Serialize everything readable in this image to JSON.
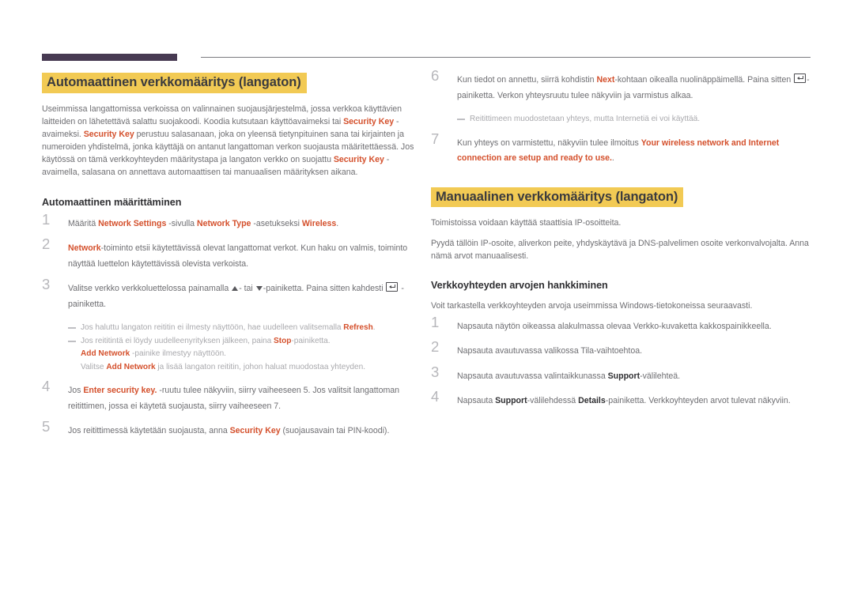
{
  "decor": {
    "bar_color": "#473a52",
    "line_color": "#7b7b80"
  },
  "theme": {
    "accent": "#d4502c",
    "highlight": "#f2ca54",
    "body_text": "#6e6e72",
    "note_text": "#a9a9ad",
    "number_color": "#b7b7bb",
    "heading_text": "#2f2f32"
  },
  "left_column": {
    "section_title": "Automaattinen verkkomääritys (langaton)",
    "intro": {
      "p1_a": "Useimmissa langattomissa verkoissa on valinnainen suojausjärjestelmä, jossa verkkoa käyttävien laitteiden on lähetettävä salattu suojakoodi. Koodia kutsutaan käyttöavaimeksi tai ",
      "p1_key1": "Security Key",
      "p1_b": " -avaimeksi. ",
      "p1_key2": "Security Key",
      "p1_c": " perustuu salasanaan, joka on yleensä tietynpituinen sana tai kirjainten ja numeroiden yhdistelmä, jonka käyttäjä on antanut langattoman verkon suojausta määritettäessä. Jos käytössä on tämä verkkoyhteyden määritystapa ja langaton verkko on suojattu ",
      "p1_key3": "Security Key",
      "p1_d": " -avaimella, salasana on annettava automaattisen tai manuaalisen määrityksen aikana."
    },
    "sub_title": "Automaattinen määrittäminen",
    "steps": [
      {
        "num": "1",
        "parts": [
          {
            "t": "Määritä ",
            "s": "plain"
          },
          {
            "t": "Network Settings",
            "s": "accent"
          },
          {
            "t": " -sivulla ",
            "s": "plain"
          },
          {
            "t": "Network Type",
            "s": "accent"
          },
          {
            "t": " -asetukseksi ",
            "s": "plain"
          },
          {
            "t": "Wireless",
            "s": "accent"
          },
          {
            "t": ".",
            "s": "plain"
          }
        ]
      },
      {
        "num": "2",
        "parts": [
          {
            "t": "Network",
            "s": "accent"
          },
          {
            "t": "-toiminto etsii käytettävissä olevat langattomat verkot. Kun haku on valmis, toiminto näyttää luettelon käytettävissä olevista verkoista.",
            "s": "plain"
          }
        ]
      },
      {
        "num": "3",
        "parts": [
          {
            "t": "Valitse verkko verkkoluettelossa painamalla ",
            "s": "plain"
          },
          {
            "t": "",
            "s": "tri-up"
          },
          {
            "t": "- tai ",
            "s": "plain"
          },
          {
            "t": "",
            "s": "tri-down"
          },
          {
            "t": "-painiketta. Paina sitten kahdesti ",
            "s": "plain"
          },
          {
            "t": "",
            "s": "enter-icon"
          },
          {
            "t": " -painiketta.",
            "s": "plain"
          }
        ],
        "notes": [
          {
            "type": "dash",
            "parts": [
              {
                "t": "Jos haluttu langaton reititin ei ilmesty näyttöön, hae uudelleen valitsemalla ",
                "s": "plain"
              },
              {
                "t": "Refresh",
                "s": "accent"
              },
              {
                "t": ".",
                "s": "plain"
              }
            ]
          },
          {
            "type": "dash",
            "parts": [
              {
                "t": "Jos reititintä ei löydy uudelleenyrityksen jälkeen, paina ",
                "s": "plain"
              },
              {
                "t": "Stop",
                "s": "accent"
              },
              {
                "t": "-painiketta.",
                "s": "plain"
              }
            ]
          },
          {
            "type": "sub",
            "parts": [
              {
                "t": "Add Network",
                "s": "accent"
              },
              {
                "t": " -painike ilmestyy näyttöön.",
                "s": "plain"
              }
            ]
          },
          {
            "type": "sub",
            "parts": [
              {
                "t": "Valitse ",
                "s": "plain"
              },
              {
                "t": "Add Network",
                "s": "accent"
              },
              {
                "t": " ja lisää langaton reititin, johon haluat muodostaa yhteyden.",
                "s": "plain"
              }
            ]
          }
        ]
      },
      {
        "num": "4",
        "parts": [
          {
            "t": "Jos ",
            "s": "plain"
          },
          {
            "t": "Enter security key.",
            "s": "accent"
          },
          {
            "t": " -ruutu tulee näkyviin, siirry vaiheeseen 5. Jos valitsit langattoman reitittimen, jossa ei käytetä suojausta, siirry vaiheeseen 7.",
            "s": "plain"
          }
        ]
      },
      {
        "num": "5",
        "parts": [
          {
            "t": "Jos reitittimessä käytetään suojausta, anna ",
            "s": "plain"
          },
          {
            "t": "Security Key",
            "s": "accent"
          },
          {
            "t": " (suojausavain tai PIN-koodi).",
            "s": "plain"
          }
        ]
      }
    ]
  },
  "right_column": {
    "steps_top": [
      {
        "num": "6",
        "parts": [
          {
            "t": "Kun tiedot on annettu, siirrä kohdistin ",
            "s": "plain"
          },
          {
            "t": "Next",
            "s": "accent"
          },
          {
            "t": "-kohtaan oikealla nuolinäppäimellä. Paina sitten ",
            "s": "plain"
          },
          {
            "t": "",
            "s": "enter-icon"
          },
          {
            "t": "-painiketta. Verkon yhteysruutu tulee näkyviin ja varmistus alkaa.",
            "s": "plain"
          }
        ],
        "notes": [
          {
            "type": "dash",
            "parts": [
              {
                "t": "Reitittimeen muodostetaan yhteys, mutta Internetiä ei voi käyttää.",
                "s": "plain"
              }
            ]
          }
        ]
      },
      {
        "num": "7",
        "parts": [
          {
            "t": "Kun yhteys on varmistettu, näkyviin tulee ilmoitus ",
            "s": "plain"
          },
          {
            "t": "Your wireless network and Internet connection are setup and ready to use.",
            "s": "accent"
          },
          {
            "t": ".",
            "s": "plain"
          }
        ]
      }
    ],
    "section_title": "Manuaalinen verkkomääritys (langaton)",
    "paragraphs": [
      "Toimistoissa voidaan käyttää staattisia IP-osoitteita.",
      "Pyydä tällöin IP-osoite, aliverkon peite, yhdyskäytävä ja DNS-palvelimen osoite verkonvalvojalta. Anna nämä arvot manuaalisesti."
    ],
    "sub_title": "Verkkoyhteyden arvojen hankkiminen",
    "sub_para": "Voit tarkastella verkkoyhteyden arvoja useimmissa Windows-tietokoneissa seuraavasti.",
    "steps_bottom": [
      {
        "num": "1",
        "parts": [
          {
            "t": "Napsauta näytön oikeassa alakulmassa olevaa Verkko-kuvaketta kakkospainikkeella.",
            "s": "plain"
          }
        ]
      },
      {
        "num": "2",
        "parts": [
          {
            "t": "Napsauta avautuvassa valikossa Tila-vaihtoehtoa.",
            "s": "plain"
          }
        ]
      },
      {
        "num": "3",
        "parts": [
          {
            "t": "Napsauta avautuvassa valintaikkunassa ",
            "s": "plain"
          },
          {
            "t": "Support",
            "s": "dark"
          },
          {
            "t": "-välilehteä.",
            "s": "plain"
          }
        ]
      },
      {
        "num": "4",
        "parts": [
          {
            "t": "Napsauta ",
            "s": "plain"
          },
          {
            "t": "Support",
            "s": "dark"
          },
          {
            "t": "-välilehdessä ",
            "s": "plain"
          },
          {
            "t": "Details",
            "s": "dark"
          },
          {
            "t": "-painiketta. Verkkoyhteyden arvot tulevat näkyviin.",
            "s": "plain"
          }
        ]
      }
    ]
  }
}
